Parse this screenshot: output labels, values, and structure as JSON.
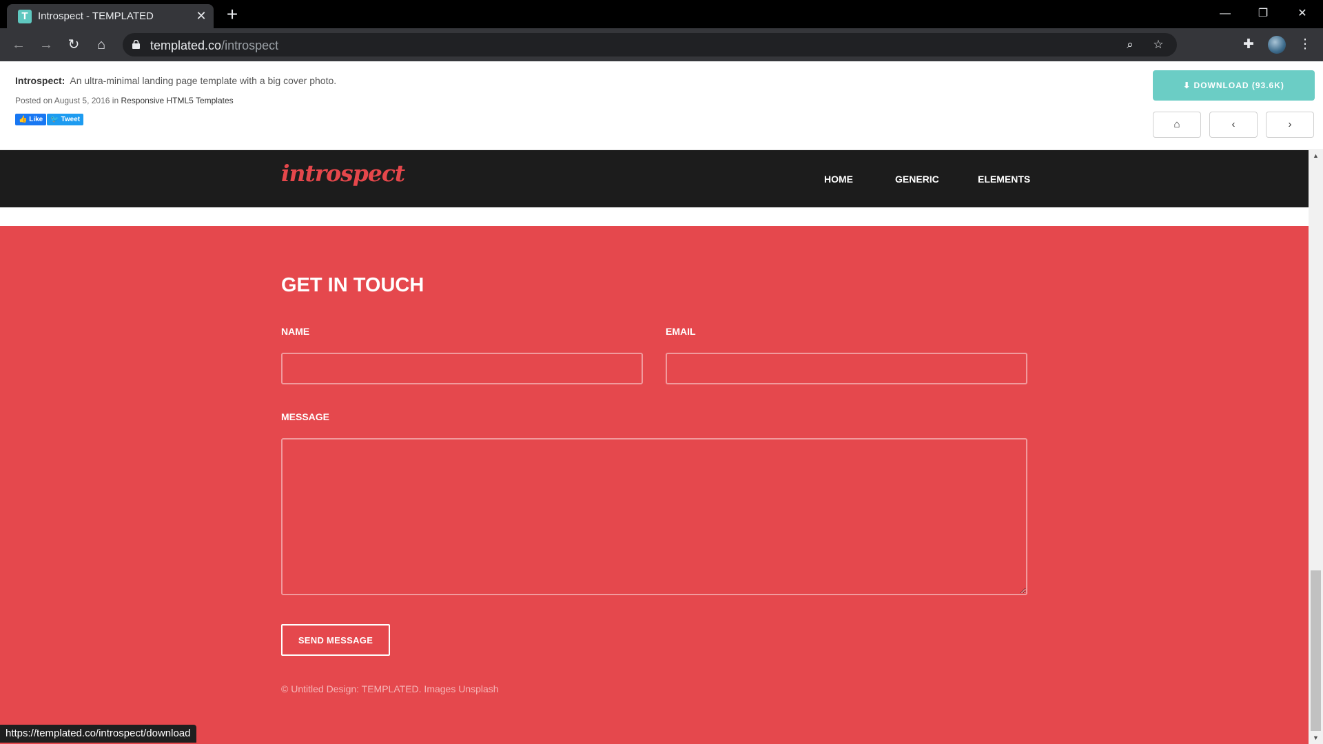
{
  "browser": {
    "tab_title": "Introspect - TEMPLATED",
    "tab_favicon_letter": "T",
    "url_host": "templated.co",
    "url_path": "/introspect",
    "status_url": "https://templated.co/introspect/download"
  },
  "templated_bar": {
    "name": "Introspect:",
    "description": "An ultra-minimal landing page template with a big cover photo.",
    "posted_prefix": "Posted on August 5, 2016 in ",
    "category": "Responsive HTML5 Templates",
    "like_label": "Like",
    "tweet_label": "Tweet",
    "download_label": "DOWNLOAD (93.6K)",
    "download_color": "#6bcdc5"
  },
  "site": {
    "logo": "introspect",
    "nav": [
      "HOME",
      "GENERIC",
      "ELEMENTS"
    ],
    "accent_color": "#e5484d"
  },
  "contact": {
    "heading": "GET IN TOUCH",
    "name_label": "NAME",
    "email_label": "EMAIL",
    "message_label": "MESSAGE",
    "name_value": "",
    "email_value": "",
    "message_value": "",
    "send_label": "SEND MESSAGE",
    "copyright": "© Untitled Design: TEMPLATED. Images Unsplash"
  },
  "icons": {
    "download": "download-icon",
    "home": "home-icon",
    "prev": "chevron-left-icon",
    "next": "chevron-right-icon"
  }
}
